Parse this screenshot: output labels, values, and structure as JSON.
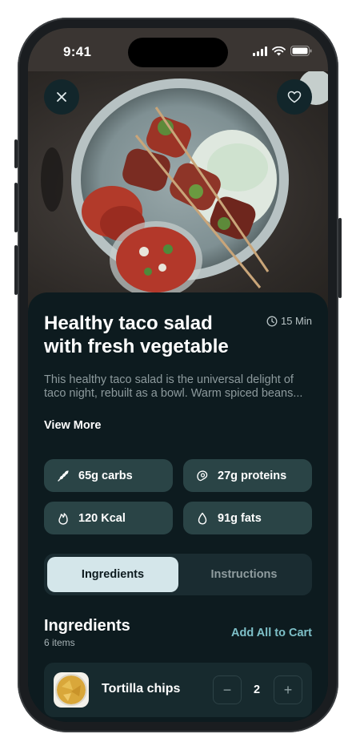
{
  "status": {
    "time": "9:41"
  },
  "recipe": {
    "title": "Healthy taco salad with fresh vegetable",
    "time": "15 Min",
    "description": "This healthy taco salad is the universal delight of taco night, rebuilt as a bowl. Warm spiced beans...",
    "view_more": "View More"
  },
  "nutrition": [
    {
      "icon": "wheat-icon",
      "label": "65g carbs"
    },
    {
      "icon": "protein-icon",
      "label": "27g proteins"
    },
    {
      "icon": "flame-icon",
      "label": "120 Kcal"
    },
    {
      "icon": "drop-icon",
      "label": "91g fats"
    }
  ],
  "tabs": [
    {
      "label": "Ingredients",
      "active": true
    },
    {
      "label": "Instructions",
      "active": false
    }
  ],
  "ingredients": {
    "title": "Ingredients",
    "count": "6 items",
    "add_all": "Add All to Cart",
    "items": [
      {
        "name": "Tortilla chips",
        "quantity": "2",
        "minus": "−",
        "plus": "+"
      }
    ]
  },
  "colors": {
    "background": "#0d1b1f",
    "chip": "#2a4446",
    "accent": "#7ec0c8",
    "active_tab": "#d4e6ea"
  }
}
